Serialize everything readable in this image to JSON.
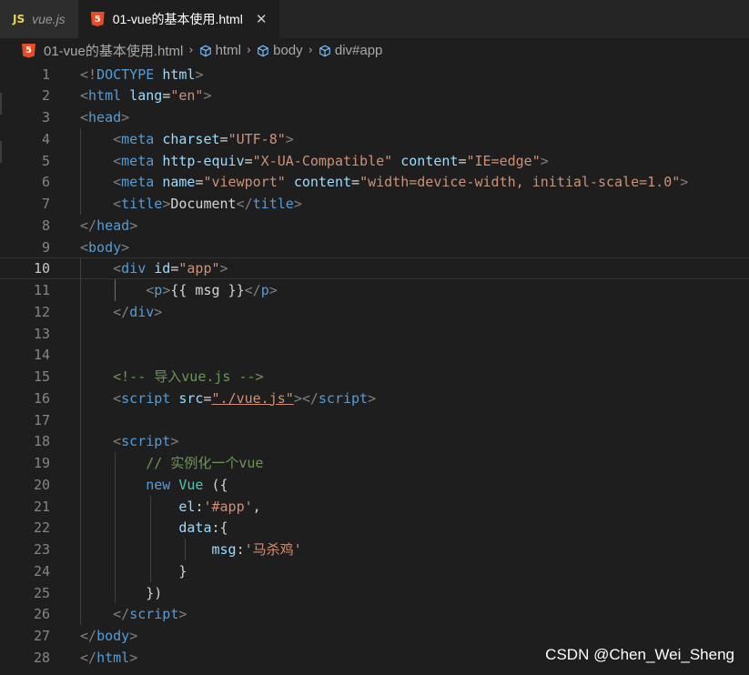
{
  "tabs": [
    {
      "icon": "js-icon",
      "icon_text": "JS",
      "label": "vue.js",
      "active": false
    },
    {
      "icon": "html5-icon",
      "icon_text": "5",
      "label": "01-vue的基本使用.html",
      "active": true,
      "close": "✕"
    }
  ],
  "breadcrumb": [
    {
      "icon": "html5-icon",
      "label": "01-vue的基本使用.html"
    },
    {
      "icon": "element-cube-icon",
      "label": "html"
    },
    {
      "icon": "element-cube-icon",
      "label": "body"
    },
    {
      "icon": "element-cube-icon",
      "label": "div#app"
    }
  ],
  "breadcrumb_separator": "›",
  "current_line": 10,
  "lines": [
    {
      "n": "1",
      "tokens": [
        [
          "lbracket",
          "<!"
        ],
        [
          "tag",
          "DOCTYPE "
        ],
        [
          "attr",
          "html"
        ],
        [
          "lbracket",
          ">"
        ]
      ]
    },
    {
      "n": "2",
      "tokens": [
        [
          "lbracket",
          "<"
        ],
        [
          "tag",
          "html "
        ],
        [
          "attr",
          "lang"
        ],
        [
          "txt",
          "="
        ],
        [
          "str",
          "\"en\""
        ],
        [
          "lbracket",
          ">"
        ]
      ]
    },
    {
      "n": "3",
      "tokens": [
        [
          "lbracket",
          "<"
        ],
        [
          "tag",
          "head"
        ],
        [
          "lbracket",
          ">"
        ]
      ]
    },
    {
      "n": "4",
      "tokens": [
        [
          "txt",
          "    "
        ],
        [
          "lbracket",
          "<"
        ],
        [
          "tag",
          "meta "
        ],
        [
          "attr",
          "charset"
        ],
        [
          "txt",
          "="
        ],
        [
          "str",
          "\"UTF-8\""
        ],
        [
          "lbracket",
          ">"
        ]
      ]
    },
    {
      "n": "5",
      "tokens": [
        [
          "txt",
          "    "
        ],
        [
          "lbracket",
          "<"
        ],
        [
          "tag",
          "meta "
        ],
        [
          "attr",
          "http-equiv"
        ],
        [
          "txt",
          "="
        ],
        [
          "str",
          "\"X-UA-Compatible\""
        ],
        [
          "txt",
          " "
        ],
        [
          "attr",
          "content"
        ],
        [
          "txt",
          "="
        ],
        [
          "str",
          "\"IE=edge\""
        ],
        [
          "lbracket",
          ">"
        ]
      ]
    },
    {
      "n": "6",
      "tokens": [
        [
          "txt",
          "    "
        ],
        [
          "lbracket",
          "<"
        ],
        [
          "tag",
          "meta "
        ],
        [
          "attr",
          "name"
        ],
        [
          "txt",
          "="
        ],
        [
          "str",
          "\"viewport\""
        ],
        [
          "txt",
          " "
        ],
        [
          "attr",
          "content"
        ],
        [
          "txt",
          "="
        ],
        [
          "str",
          "\"width=device-width, initial-scale=1.0\""
        ],
        [
          "lbracket",
          ">"
        ]
      ]
    },
    {
      "n": "7",
      "tokens": [
        [
          "txt",
          "    "
        ],
        [
          "lbracket",
          "<"
        ],
        [
          "tag",
          "title"
        ],
        [
          "lbracket",
          ">"
        ],
        [
          "txt",
          "Document"
        ],
        [
          "lbracket",
          "</"
        ],
        [
          "tag",
          "title"
        ],
        [
          "lbracket",
          ">"
        ]
      ]
    },
    {
      "n": "8",
      "tokens": [
        [
          "lbracket",
          "</"
        ],
        [
          "tag",
          "head"
        ],
        [
          "lbracket",
          ">"
        ]
      ]
    },
    {
      "n": "9",
      "tokens": [
        [
          "lbracket",
          "<"
        ],
        [
          "tag",
          "body"
        ],
        [
          "lbracket",
          ">"
        ]
      ]
    },
    {
      "n": "10",
      "tokens": [
        [
          "txt",
          "    "
        ],
        [
          "lbracket",
          "<"
        ],
        [
          "tag",
          "div "
        ],
        [
          "attr",
          "id"
        ],
        [
          "txt",
          "="
        ],
        [
          "str",
          "\"app\""
        ],
        [
          "lbracket",
          ">"
        ]
      ]
    },
    {
      "n": "11",
      "tokens": [
        [
          "txt",
          "        "
        ],
        [
          "lbracket",
          "<"
        ],
        [
          "tag",
          "p"
        ],
        [
          "lbracket",
          ">"
        ],
        [
          "txt",
          "{{ msg }}"
        ],
        [
          "lbracket",
          "</"
        ],
        [
          "tag",
          "p"
        ],
        [
          "lbracket",
          ">"
        ]
      ]
    },
    {
      "n": "12",
      "tokens": [
        [
          "txt",
          "    "
        ],
        [
          "lbracket",
          "</"
        ],
        [
          "tag",
          "div"
        ],
        [
          "lbracket",
          ">"
        ]
      ]
    },
    {
      "n": "13",
      "tokens": []
    },
    {
      "n": "14",
      "tokens": []
    },
    {
      "n": "15",
      "tokens": [
        [
          "txt",
          "    "
        ],
        [
          "cmt",
          "<!-- 导入vue.js -->"
        ]
      ]
    },
    {
      "n": "16",
      "tokens": [
        [
          "txt",
          "    "
        ],
        [
          "lbracket",
          "<"
        ],
        [
          "tag",
          "script "
        ],
        [
          "attr",
          "src"
        ],
        [
          "txt",
          "="
        ],
        [
          "str",
          "\"./vue.js\""
        ],
        [
          "lbracket",
          "></"
        ],
        [
          "tag",
          "script"
        ],
        [
          "lbracket",
          ">"
        ]
      ]
    },
    {
      "n": "17",
      "tokens": []
    },
    {
      "n": "18",
      "tokens": [
        [
          "txt",
          "    "
        ],
        [
          "lbracket",
          "<"
        ],
        [
          "tag",
          "script"
        ],
        [
          "lbracket",
          ">"
        ]
      ]
    },
    {
      "n": "19",
      "tokens": [
        [
          "txt",
          "        "
        ],
        [
          "cmt",
          "// 实例化一个vue"
        ]
      ]
    },
    {
      "n": "20",
      "tokens": [
        [
          "txt",
          "        "
        ],
        [
          "kw",
          "new "
        ],
        [
          "cls",
          "Vue"
        ],
        [
          "txt",
          " ({"
        ]
      ]
    },
    {
      "n": "21",
      "tokens": [
        [
          "txt",
          "            "
        ],
        [
          "prop",
          "el"
        ],
        [
          "txt",
          ":"
        ],
        [
          "str",
          "'#app'"
        ],
        [
          "txt",
          ","
        ]
      ]
    },
    {
      "n": "22",
      "tokens": [
        [
          "txt",
          "            "
        ],
        [
          "prop",
          "data"
        ],
        [
          "txt",
          ":{"
        ]
      ]
    },
    {
      "n": "23",
      "tokens": [
        [
          "txt",
          "                "
        ],
        [
          "prop",
          "msg"
        ],
        [
          "txt",
          ":"
        ],
        [
          "str",
          "'马杀鸡'"
        ]
      ]
    },
    {
      "n": "24",
      "tokens": [
        [
          "txt",
          "            }"
        ]
      ]
    },
    {
      "n": "25",
      "tokens": [
        [
          "txt",
          "        })"
        ]
      ]
    },
    {
      "n": "26",
      "tokens": [
        [
          "txt",
          "    "
        ],
        [
          "lbracket",
          "</"
        ],
        [
          "tag",
          "script"
        ],
        [
          "lbracket",
          ">"
        ]
      ]
    },
    {
      "n": "27",
      "tokens": [
        [
          "lbracket",
          "</"
        ],
        [
          "tag",
          "body"
        ],
        [
          "lbracket",
          ">"
        ]
      ]
    },
    {
      "n": "28",
      "tokens": [
        [
          "lbracket",
          "</"
        ],
        [
          "tag",
          "html"
        ],
        [
          "lbracket",
          ">"
        ]
      ]
    }
  ],
  "watermark": "CSDN @Chen_Wei_Sheng",
  "colors": {
    "editor_bg": "#1e1e1e",
    "tag": "#569cd6",
    "attribute": "#9cdcfe",
    "string": "#ce9178",
    "comment": "#6a9955",
    "class": "#4ec9b0"
  }
}
